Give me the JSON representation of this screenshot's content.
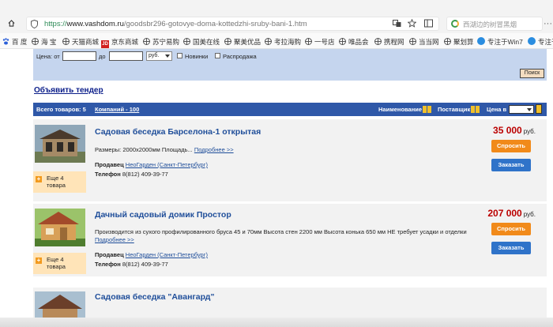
{
  "browser": {
    "url_scheme": "https://",
    "url_host": "www.vashdom.ru",
    "url_path": "/goodsbr296-gotovye-doma-kottedzhi-sruby-bani-1.htm",
    "search_placeholder": "西湖边的树冒黑烟",
    "menu_label": "···",
    "bookmarks": [
      {
        "label": "百 度",
        "icon": "paw-icon"
      },
      {
        "label": "海 宝",
        "icon": "globe-icon"
      },
      {
        "label": "天猫商城",
        "icon": "globe-icon"
      },
      {
        "label": "京东商城",
        "icon": "jd-icon"
      },
      {
        "label": "苏宁易购",
        "icon": "globe-icon"
      },
      {
        "label": "国美在线",
        "icon": "globe-icon"
      },
      {
        "label": "聚美优品",
        "icon": "globe-icon"
      },
      {
        "label": "考拉海购",
        "icon": "globe-icon"
      },
      {
        "label": "一号店",
        "icon": "globe-icon"
      },
      {
        "label": "唯品会",
        "icon": "globe-icon"
      },
      {
        "label": "携程网",
        "icon": "globe-icon"
      },
      {
        "label": "当当网",
        "icon": "globe-icon"
      },
      {
        "label": "聚划算",
        "icon": "globe-icon"
      },
      {
        "label": "专注于Win7",
        "icon": "win7-icon"
      },
      {
        "label": "专注于",
        "icon": "win7-icon"
      }
    ]
  },
  "filter": {
    "price_label": "Цена: от",
    "to_label": "до",
    "currency": "руб.",
    "new_label": "Новинки",
    "sale_label": "Распродажа",
    "search_button": "Поиск"
  },
  "tender_link": "Объявить тендер",
  "listbar": {
    "total": "Всего товаров: 5",
    "companies": "Компаний - 100",
    "sort_name": "Наименование",
    "sort_supplier": "Поставщик",
    "sort_price": "Цена в"
  },
  "items": [
    {
      "title": "Садовая беседка Барселона-1 открытая",
      "desc": "Размеры: 2000х2000мм Площадь...",
      "more_link": "Подробнее >>",
      "seller_label": "Продавец",
      "seller": "НеоГарден (Санкт-Петербург)",
      "phone_label": "Телефон",
      "phone": "8(812) 409-39-77",
      "price": "35 000",
      "currency": "руб.",
      "ask": "Спросить",
      "order": "Заказать",
      "more_items": "Еще 4 товара"
    },
    {
      "title": "Дачный садовый домик Простор",
      "desc": "Производится из сухого профилированного бруса 45 и 70мм Высота стен 2200 мм Высота конька 650 мм НЕ требует усадки и отделки",
      "more_link": "Подробнее >>",
      "seller_label": "Продавец",
      "seller": "НеоГарден (Санкт-Петербург)",
      "phone_label": "Телефон",
      "phone": "8(812) 409-39-77",
      "price": "207 000",
      "currency": "руб.",
      "ask": "Спросить",
      "order": "Заказать",
      "more_items": "Еще 4 товара"
    },
    {
      "title": "Садовая беседка \"Авангард\""
    }
  ]
}
